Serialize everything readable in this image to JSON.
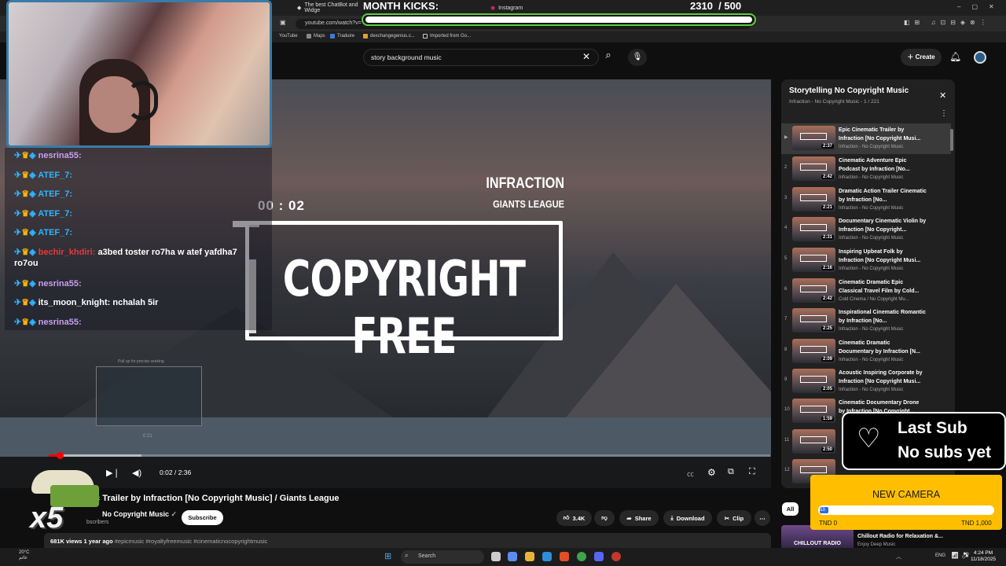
{
  "browser": {
    "tabs": [
      {
        "label": "The best ChatBot and Widge"
      },
      {
        "label": "Instagram"
      }
    ],
    "url": "youtube.com/watch?v=",
    "bookmarks": [
      "YouTube",
      "Maps",
      "Traduire",
      "dexchangegenius.c...",
      "Imported from Go..."
    ]
  },
  "youtube": {
    "search_query": "story background music",
    "create_label": "Create",
    "player": {
      "overlay_time": "00 : 02",
      "artist": "INFRACTION",
      "label": "GIANTS LEAGUE",
      "headline": "COPYRIGHT FREE",
      "preview_hint": "Pull up for precise seeking",
      "preview_time": "0:21",
      "time_display": "0:02 / 2:36",
      "progress": 0.013
    },
    "video": {
      "title": "ic Trailer by Infraction [No Copyright Music] / Giants League",
      "channel": "No Copyright Music",
      "subscribers": "bscribers",
      "subscribe_label": "Subscribe",
      "likes": "3.4K",
      "share_label": "Share",
      "download_label": "Download",
      "clip_label": "Clip",
      "views": "681K views",
      "age": "1 year ago",
      "tags": "#epicmusic #royaltyfreemusic #cinematicnocopyrightmusic"
    },
    "playlist": {
      "title": "Storytelling No Copyright Music",
      "subtitle": "Infraction - No Copyright Music - 1 / 221",
      "items": [
        {
          "n": "▶",
          "title": "Epic Cinematic Trailer by Infraction [No Copyright Musi...",
          "channel": "Infraction - No Copyright Music",
          "dur": "2:37"
        },
        {
          "n": "2",
          "title": "Cinematic Adventure Epic Podcast by Infraction [No...",
          "channel": "Infraction - No Copyright Music",
          "dur": "2:42"
        },
        {
          "n": "3",
          "title": "Dramatic Action Trailer Cinematic by Infraction [No...",
          "channel": "Infraction - No Copyright Music",
          "dur": "2:21"
        },
        {
          "n": "4",
          "title": "Documentary Cinematic Violin by Infraction [No Copyright...",
          "channel": "Infraction - No Copyright Music",
          "dur": "2:31"
        },
        {
          "n": "5",
          "title": "Inspiring Upbeat Folk by Infraction [No Copyright Musi...",
          "channel": "Infraction - No Copyright Music",
          "dur": "2:16"
        },
        {
          "n": "6",
          "title": "Cinematic Dramatic Epic Classical Travel Film by Cold...",
          "channel": "Cold Cinema / No Copyright Mu...",
          "dur": "2:42"
        },
        {
          "n": "7",
          "title": "Inspirational Cinematic Romantic by Infraction [No...",
          "channel": "Infraction - No Copyright Music",
          "dur": "2:25"
        },
        {
          "n": "8",
          "title": "Cinematic Dramatic Documentary by Infraction [N...",
          "channel": "Infraction - No Copyright Music",
          "dur": "2:09"
        },
        {
          "n": "9",
          "title": "Acoustic Inspiring Corporate by Infraction [No Copyright Musi...",
          "channel": "Infraction - No Copyright Music",
          "dur": "2:05"
        },
        {
          "n": "10",
          "title": "Cinematic Documentary Drone by Infraction [No Copyright...",
          "channel": "",
          "dur": "1:59"
        },
        {
          "n": "11",
          "title": "",
          "channel": "",
          "dur": "2:50"
        },
        {
          "n": "12",
          "title": "",
          "channel": "Infraction - No Copyright Musi...",
          "dur": ""
        }
      ],
      "chip_all": "All",
      "next_title": "Chillout Radio for Relaxation &...",
      "next_channel": "Enjoy Deep Music",
      "next_thumb_label": "CHILLOUT RADIO"
    }
  },
  "overlay": {
    "month_label": "MONTH KICKS:",
    "month_count": "2310",
    "month_goal": "/ 500",
    "chat": [
      {
        "user": "nesrina55:",
        "msg": "",
        "color": "#c99ff0"
      },
      {
        "user": "ATEF_7:",
        "msg": "",
        "color": "#2fb5ff"
      },
      {
        "user": "ATEF_7:",
        "msg": "",
        "color": "#2fb5ff"
      },
      {
        "user": "ATEF_7:",
        "msg": "",
        "color": "#2fb5ff"
      },
      {
        "user": "ATEF_7:",
        "msg": "",
        "color": "#2fb5ff"
      },
      {
        "user": "bechir_khdiri:",
        "msg": "a3bed toster ro7ha w atef yafdha7",
        "msg2": "ro7ou",
        "color": "#e33b3b"
      },
      {
        "user": "nesrina55:",
        "msg": "",
        "color": "#c99ff0"
      },
      {
        "user": "its_moon_knight:",
        "msg": "nchalah 5ir",
        "color": "#ffffff"
      },
      {
        "user": "nesrina55:",
        "msg": "",
        "color": "#c99ff0"
      }
    ],
    "multiplier": "x5",
    "last_sub_title": "Last Sub",
    "last_sub_value": "No subs yet",
    "goal_title": "NEW CAMERA",
    "goal_min": "TND 0",
    "goal_max": "TND 1,000",
    "goal_fill_text": "53",
    "goal_progress": 0.053
  },
  "taskbar": {
    "weather": "20°C",
    "weather_sub": "غائم",
    "search": "Search",
    "lang": "ENG",
    "time": "4:24 PM",
    "date": "11/18/2025"
  }
}
